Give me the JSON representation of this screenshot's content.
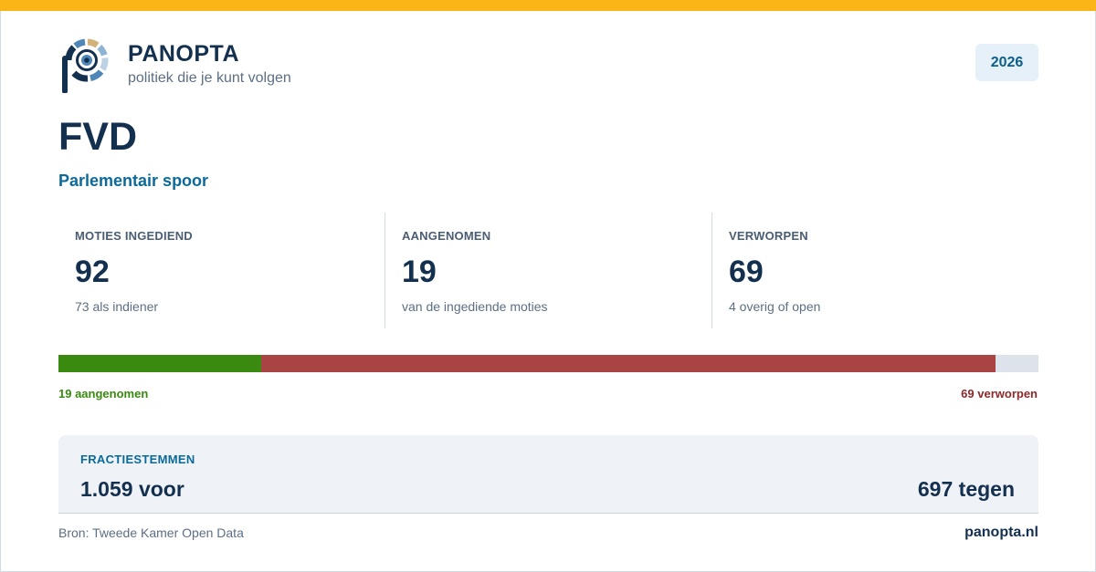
{
  "brand": {
    "name": "PANOPTA",
    "tagline": "politiek die je kunt volgen",
    "logo_icon": "panopta-eye-logo-icon",
    "accent_color": "#fbb516"
  },
  "year": "2026",
  "party": "FVD",
  "section": "Parlementair spoor",
  "stats": [
    {
      "label": "MOTIES INGEDIEND",
      "value": "92",
      "sub": "73 als indiener"
    },
    {
      "label": "AANGENOMEN",
      "value": "19",
      "sub": "van de ingediende moties"
    },
    {
      "label": "VERWORPEN",
      "value": "69",
      "sub": "4 overig of open"
    }
  ],
  "progress": {
    "total": 92,
    "adopted": 19,
    "rejected": 69,
    "adopted_color": "#3a8a10",
    "rejected_color": "#a84444",
    "adopted_label": "19 aangenomen",
    "rejected_label": "69 verworpen"
  },
  "faction_votes": {
    "label": "FRACTIESTEMMEN",
    "for": "1.059 voor",
    "against": "697 tegen"
  },
  "footer": {
    "source": "Bron: Tweede Kamer Open Data",
    "site": "panopta.nl"
  }
}
